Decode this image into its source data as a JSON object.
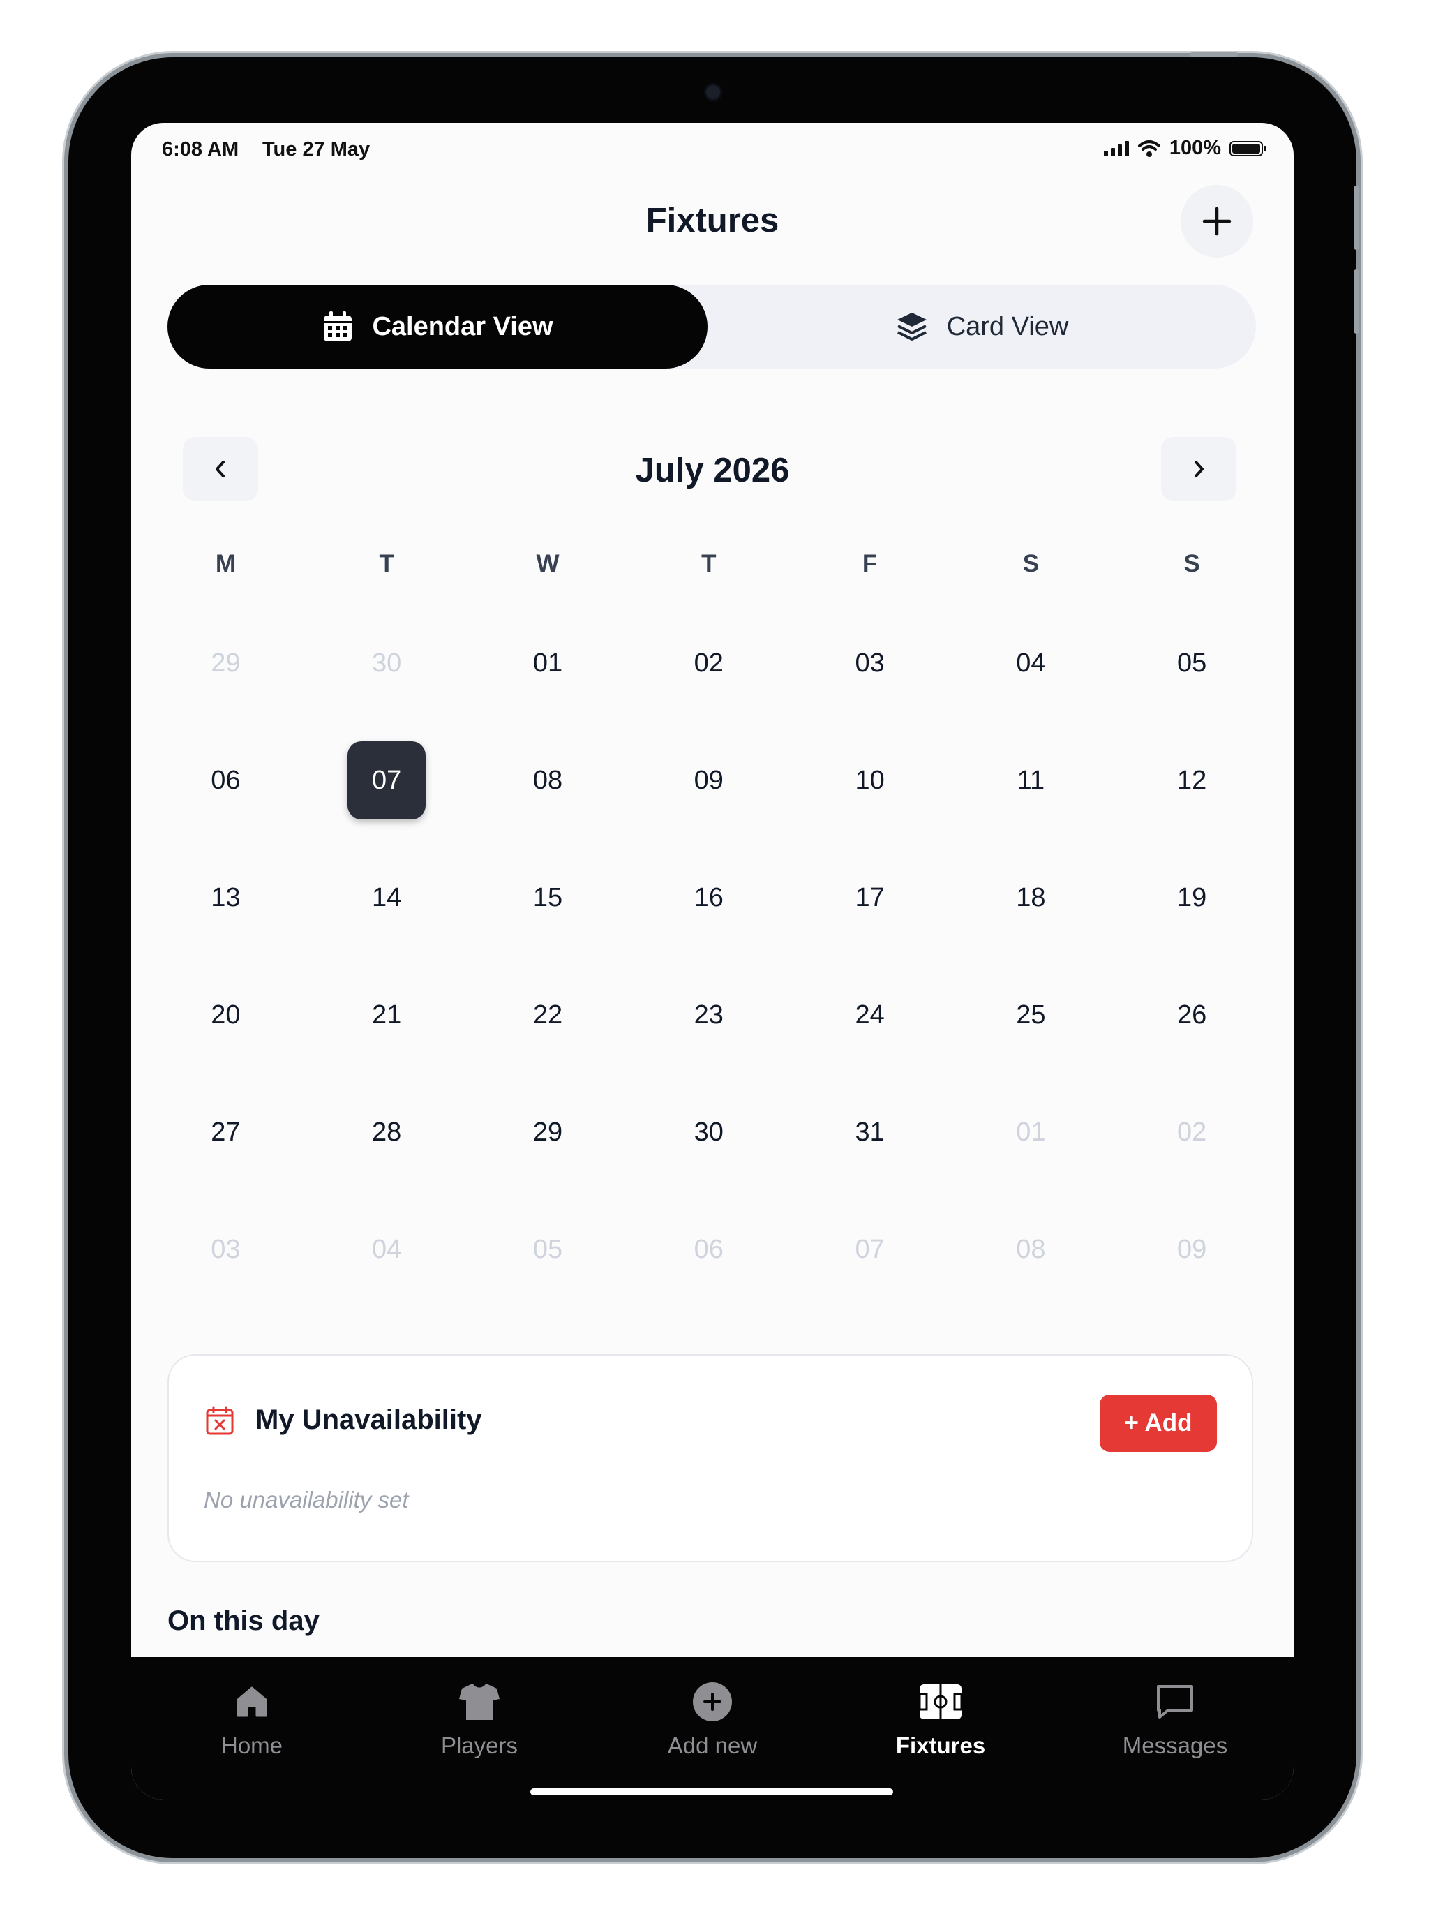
{
  "status_bar": {
    "time": "6:08 AM",
    "date": "Tue 27 May",
    "battery": "100%"
  },
  "header": {
    "title": "Fixtures",
    "add_icon": "plus-icon"
  },
  "view_toggle": {
    "calendar_label": "Calendar View",
    "card_label": "Card View",
    "active": "calendar"
  },
  "calendar": {
    "month_label": "July 2026",
    "weekdays": [
      "M",
      "T",
      "W",
      "T",
      "F",
      "S",
      "S"
    ],
    "weeks": [
      [
        "29",
        "30",
        "01",
        "02",
        "03",
        "04",
        "05"
      ],
      [
        "06",
        "07",
        "08",
        "09",
        "10",
        "11",
        "12"
      ],
      [
        "13",
        "14",
        "15",
        "16",
        "17",
        "18",
        "19"
      ],
      [
        "20",
        "21",
        "22",
        "23",
        "24",
        "25",
        "26"
      ],
      [
        "27",
        "28",
        "29",
        "30",
        "31",
        "01",
        "02"
      ],
      [
        "03",
        "04",
        "05",
        "06",
        "07",
        "08",
        "09"
      ]
    ],
    "selected_day": "07"
  },
  "unavailability": {
    "title": "My Unavailability",
    "add_label": "+ Add",
    "empty_text": "No unavailability set",
    "accent_color": "#e53935"
  },
  "on_this_day": {
    "title": "On this day"
  },
  "tab_bar": {
    "items": [
      {
        "label": "Home",
        "icon": "home-icon"
      },
      {
        "label": "Players",
        "icon": "shirt-icon"
      },
      {
        "label": "Add new",
        "icon": "add-circle-icon"
      },
      {
        "label": "Fixtures",
        "icon": "pitch-icon"
      },
      {
        "label": "Messages",
        "icon": "message-icon"
      }
    ],
    "active": "Fixtures"
  }
}
